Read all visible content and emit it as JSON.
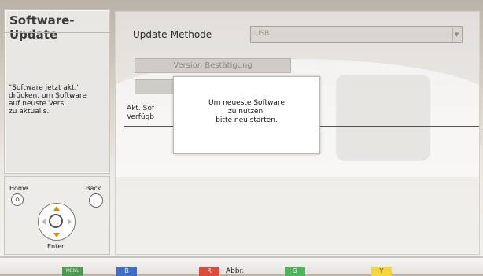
{
  "sidebar": {
    "title": "Software-Update",
    "description": "\"Software jetzt akt.\"\ndrücken, um Software\nauf neuste Vers.\nzu aktualis."
  },
  "remote": {
    "home_label": "Home",
    "back_label": "Back",
    "enter_label": "Enter"
  },
  "main": {
    "update_method_label": "Update-Methode",
    "update_method_value": "USB",
    "version_button_label": "Version Bestätigung",
    "second_button_label": "",
    "akt_label": "Akt. Sof\nVerfügb"
  },
  "popup": {
    "message": "Um neueste Software\nzu nutzen,\nbitte neu starten."
  },
  "footer": {
    "menu_key": "MENU",
    "b_key": "B",
    "r_key": "R",
    "r_label": "Abbr.",
    "g_key": "G",
    "y_key": "Y"
  },
  "colors": {
    "key_menu": "#4d9a52",
    "key_b": "#3f6ec8",
    "key_r": "#e04a3a",
    "key_g": "#4db35a",
    "key_y": "#f2d63a"
  }
}
